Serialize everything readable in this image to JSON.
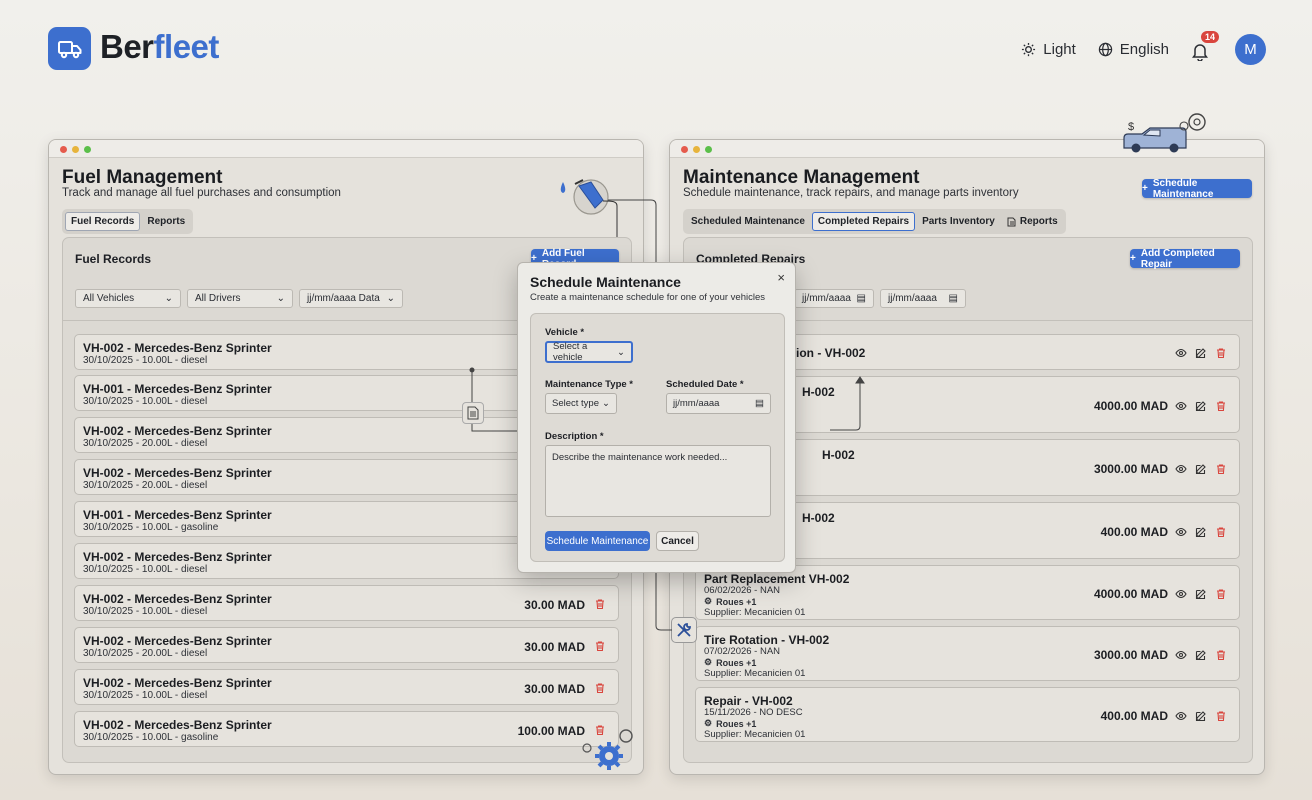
{
  "app": {
    "brand_part1": "Ber",
    "brand_part2": "fleet",
    "theme_label": "Light",
    "language_label": "English",
    "notification_count": "14",
    "avatar_initial": "M"
  },
  "fuel": {
    "title": "Fuel Management",
    "subtitle": "Track and manage all fuel purchases and consumption",
    "tabs": [
      "Fuel Records",
      "Reports"
    ],
    "panel_title": "Fuel Records",
    "add_button": "Add Fuel Record",
    "filters": {
      "vehicles": "All Vehicles",
      "drivers": "All Drivers",
      "date": "jj/mm/aaaa Data"
    },
    "records": [
      {
        "title": "VH-002 - Mercedes-Benz Sprinter",
        "sub": "30/10/2025 - 10.00L - diesel",
        "amount": ""
      },
      {
        "title": "VH-001 - Mercedes-Benz Sprinter",
        "sub": "30/10/2025 - 10.00L - diesel",
        "amount": ""
      },
      {
        "title": "VH-002 - Mercedes-Benz Sprinter",
        "sub": "30/10/2025 - 20.00L - diesel",
        "amount": ""
      },
      {
        "title": "VH-002 - Mercedes-Benz Sprinter",
        "sub": "30/10/2025 - 20.00L - diesel",
        "amount": ""
      },
      {
        "title": "VH-001 - Mercedes-Benz Sprinter",
        "sub": "30/10/2025 - 10.00L - gasoline",
        "amount": ""
      },
      {
        "title": "VH-002 - Mercedes-Benz Sprinter",
        "sub": "30/10/2025 - 10.00L - diesel",
        "amount": ""
      },
      {
        "title": "VH-002 - Mercedes-Benz Sprinter",
        "sub": "30/10/2025 - 10.00L - diesel",
        "amount": "30.00 MAD"
      },
      {
        "title": "VH-002 - Mercedes-Benz Sprinter",
        "sub": "30/10/2025 - 20.00L - diesel",
        "amount": "30.00 MAD"
      },
      {
        "title": "VH-002 - Mercedes-Benz Sprinter",
        "sub": "30/10/2025 - 10.00L - diesel",
        "amount": "30.00 MAD"
      },
      {
        "title": "VH-002 - Mercedes-Benz Sprinter",
        "sub": "30/10/2025 - 10.00L - gasoline",
        "amount": "100.00 MAD"
      }
    ]
  },
  "maintenance": {
    "title": "Maintenance Management",
    "subtitle": "Schedule maintenance, track repairs, and manage parts inventory",
    "schedule_button": "Schedule Maintenance",
    "tabs": [
      "Scheduled Maintenance",
      "Completed Repairs",
      "Parts Inventory",
      "Reports"
    ],
    "panel_title": "Completed Repairs",
    "add_button": "Add Completed Repair",
    "date_filter_1": "jj/mm/aaaa",
    "date_filter_2": "jj/mm/aaaa",
    "repairs": [
      {
        "title": "lation - VH-002",
        "date": "",
        "chip": "",
        "supplier": "",
        "amount": ""
      },
      {
        "title": "H-002",
        "date": "",
        "chip": "",
        "supplier": "",
        "amount": "4000.00 MAD"
      },
      {
        "title": "H-002",
        "date": "",
        "chip": "",
        "supplier": "",
        "amount": "3000.00 MAD"
      },
      {
        "title": "H-002",
        "date": "",
        "chip": "",
        "supplier": "",
        "amount": "400.00 MAD"
      },
      {
        "title": "Part Replacement VH-002",
        "date": "06/02/2026 - NAN",
        "chip": "Roues +1",
        "supplier": "Supplier: Mecanicien 01",
        "amount": "4000.00 MAD"
      },
      {
        "title": "Tire Rotation - VH-002",
        "date": "07/02/2026 - NAN",
        "chip": "Roues +1",
        "supplier": "Supplier: Mecanicien 01",
        "amount": "3000.00 MAD"
      },
      {
        "title": "Repair - VH-002",
        "date": "15/11/2026 - NO DESC",
        "chip": "Roues +1",
        "supplier": "Supplier: Mecanicien 01",
        "amount": "400.00 MAD"
      }
    ]
  },
  "modal": {
    "title": "Schedule Maintenance",
    "subtitle": "Create a maintenance schedule for one of your vehicles",
    "close": "×",
    "vehicle_label": "Vehicle *",
    "vehicle_value": "Select a vehicle",
    "type_label": "Maintenance Type *",
    "type_value": "Select type",
    "date_label": "Scheduled Date *",
    "date_value": "jj/mm/aaaa",
    "description_label": "Description *",
    "description_placeholder": "Describe the maintenance work needed...",
    "submit": "Schedule Maintenance",
    "cancel": "Cancel"
  },
  "colors": {
    "accent": "#3d6fce",
    "danger": "#d9453d",
    "background": "#f1f0ec"
  }
}
